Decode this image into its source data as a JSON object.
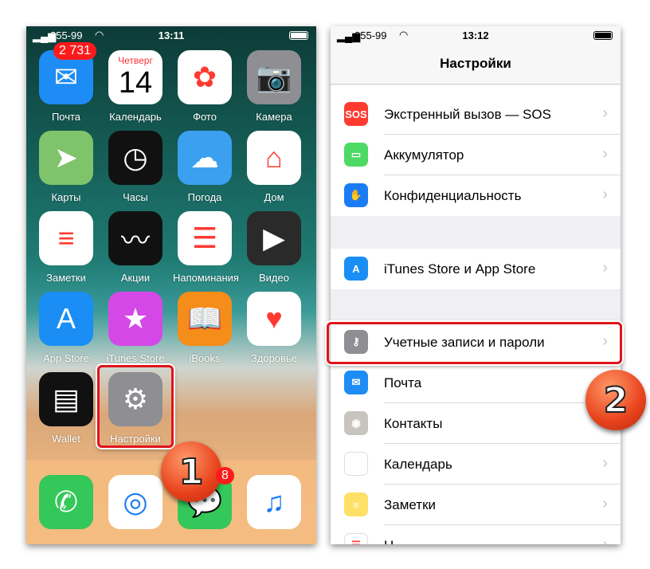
{
  "left_phone": {
    "status": {
      "carrier": "255-99",
      "time": "13:11"
    },
    "apps": [
      {
        "label": "Почта",
        "icon": "mail-icon",
        "color": "#1e8cf5",
        "badge": "2 731"
      },
      {
        "label": "Календарь",
        "icon": "calendar-icon",
        "color": "#ffffff",
        "day": "Четверг",
        "date": "14"
      },
      {
        "label": "Фото",
        "icon": "photos-icon",
        "color": "#ffffff"
      },
      {
        "label": "Камера",
        "icon": "camera-icon",
        "color": "#8e8e93"
      },
      {
        "label": "Карты",
        "icon": "maps-icon",
        "color": "#7fc36a"
      },
      {
        "label": "Часы",
        "icon": "clock-icon",
        "color": "#111111"
      },
      {
        "label": "Погода",
        "icon": "weather-icon",
        "color": "#3aa0ef"
      },
      {
        "label": "Дом",
        "icon": "home-icon",
        "color": "#ffffff"
      },
      {
        "label": "Заметки",
        "icon": "notes-icon",
        "color": "#ffffff"
      },
      {
        "label": "Акции",
        "icon": "stocks-icon",
        "color": "#111111"
      },
      {
        "label": "Напоминания",
        "icon": "reminders-icon",
        "color": "#ffffff"
      },
      {
        "label": "Видео",
        "icon": "videos-icon",
        "color": "#2a2a2a"
      },
      {
        "label": "App Store",
        "icon": "app-store-icon",
        "color": "#1a8ef5"
      },
      {
        "label": "iTunes Store",
        "icon": "itunes-store-icon",
        "color": "#d548e8"
      },
      {
        "label": "iBooks",
        "icon": "ibooks-icon",
        "color": "#f58d1a"
      },
      {
        "label": "Здоровье",
        "icon": "health-icon",
        "color": "#ffffff"
      },
      {
        "label": "Wallet",
        "icon": "wallet-icon",
        "color": "#111111"
      },
      {
        "label": "Настройки",
        "icon": "settings-gear-icon",
        "color": "#8e8e93"
      }
    ],
    "dock": [
      {
        "icon": "phone-icon",
        "color": "#34c759"
      },
      {
        "icon": "safari-icon",
        "color": "#ffffff"
      },
      {
        "icon": "messages-icon",
        "color": "#34c759",
        "badge": "8"
      },
      {
        "icon": "music-icon",
        "color": "#ffffff"
      }
    ]
  },
  "right_phone": {
    "status": {
      "carrier": "255-99",
      "time": "13:12"
    },
    "title": "Настройки",
    "rows": [
      {
        "label": "Экстренный вызов — SOS",
        "icon": "sos-icon",
        "icon_text": "SOS",
        "color": "#ff3b30"
      },
      {
        "label": "Аккумулятор",
        "icon": "battery-icon",
        "color": "#4cd964"
      },
      {
        "label": "Конфиденциальность",
        "icon": "privacy-hand-icon",
        "color": "#1a7cf5"
      },
      {
        "label": "iTunes Store и App Store",
        "icon": "app-store-icon",
        "color": "#1a8ef5"
      },
      {
        "label": "Учетные записи и пароли",
        "icon": "key-icon",
        "color": "#8e8e93"
      },
      {
        "label": "Почта",
        "icon": "mail-icon",
        "color": "#1e8cf5"
      },
      {
        "label": "Контакты",
        "icon": "contacts-icon",
        "color": "#c8c4be"
      },
      {
        "label": "Календарь",
        "icon": "calendar-icon",
        "color": "#ffffff"
      },
      {
        "label": "Заметки",
        "icon": "notes-icon",
        "color": "#ffe066"
      },
      {
        "label": "Н",
        "icon": "reminders-icon",
        "color": "#ffffff"
      }
    ]
  },
  "annotations": {
    "step1": "1",
    "step2": "2",
    "highlight_color": "#e0141c"
  }
}
